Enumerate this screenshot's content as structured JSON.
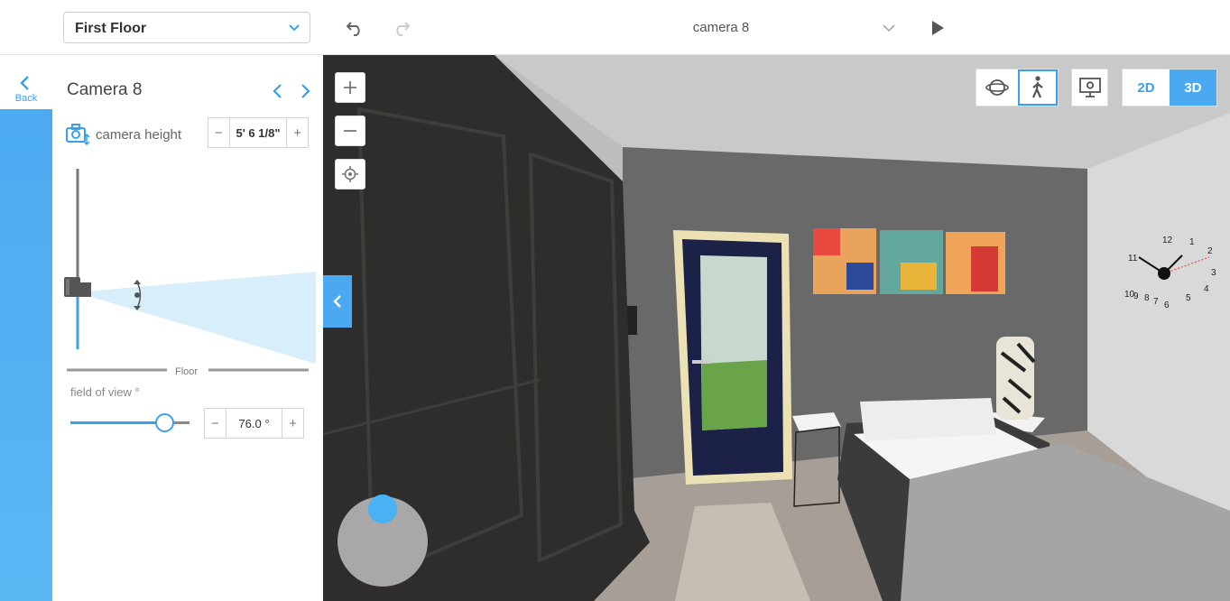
{
  "topbar": {
    "floor_select": {
      "label": "First Floor"
    },
    "camera_title": "camera 8",
    "undo_icon": "undo-arrow",
    "redo_icon": "redo-arrow",
    "play_icon": "play-triangle"
  },
  "sidebar": {
    "back_label": "Back"
  },
  "panel": {
    "title": "Camera 8",
    "camera_height_label": "camera height",
    "camera_height_value": "5' 6 1/8\"",
    "floor_label": "Floor",
    "fov_label": "field of view °",
    "fov_value": "76.0 °",
    "fov_fraction": 0.79,
    "minus": "−",
    "plus": "+"
  },
  "viewport": {
    "view_2d": "2D",
    "view_3d": "3D",
    "clock_numbers": [
      "12",
      "1",
      "2",
      "3",
      "4",
      "5",
      "6",
      "7",
      "8",
      "9",
      "10",
      "11"
    ]
  },
  "colors": {
    "accent": "#3aa0ea",
    "accent_light": "#d8eefb"
  }
}
